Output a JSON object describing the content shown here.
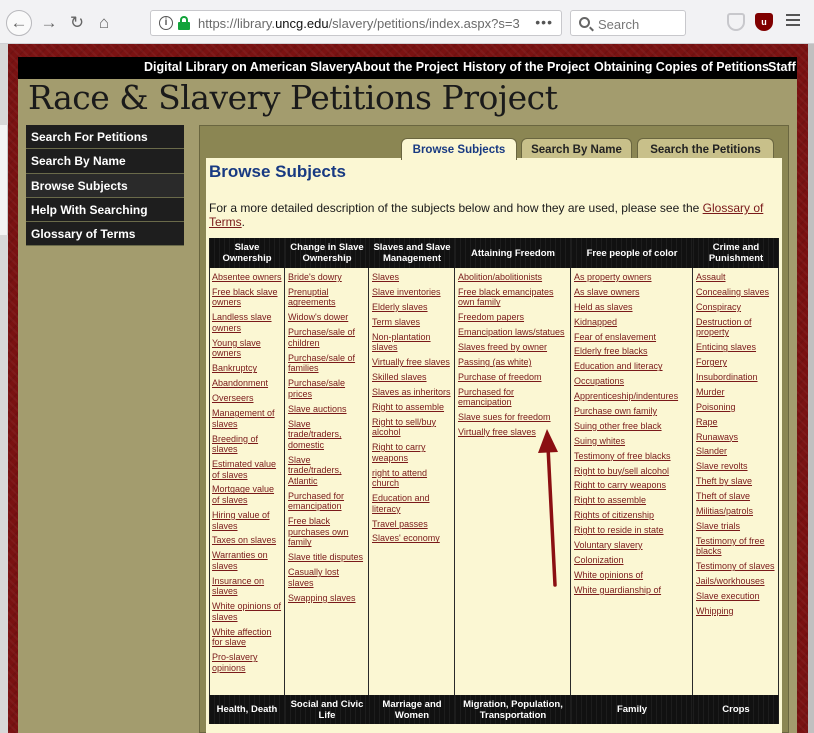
{
  "browser": {
    "url_prefix": "https://library.",
    "url_domain": "uncg.edu",
    "url_suffix": "/slavery/petitions/index.aspx?s=3",
    "search_placeholder": "Search",
    "more_label": "•••",
    "ublock_label": "u"
  },
  "site": {
    "title": "Race & Slavery Petitions Project",
    "topnav": [
      "Digital Library on American Slavery",
      "About the Project",
      "History of the Project",
      "Obtaining Copies of Petitions",
      "Staff"
    ]
  },
  "sidebar": {
    "items": [
      "Search For Petitions",
      "Search By Name",
      "Browse Subjects",
      "Help With Searching",
      "Glossary of Terms"
    ]
  },
  "tabs": {
    "browse": "Browse Subjects",
    "by_name": "Search By Name",
    "search": "Search the Petitions"
  },
  "main": {
    "title": "Browse Subjects",
    "intro_text": "For a more detailed description of the subjects below and how they are used, please see the ",
    "intro_link": "Glossary of Terms",
    "intro_end": "."
  },
  "subjects": {
    "columns": [
      {
        "header": "Slave Ownership",
        "items": [
          "Absentee owners",
          "Free black slave owners",
          "Landless slave owners",
          "Young slave owners",
          "Bankruptcy",
          "Abandonment",
          "Overseers",
          "Management of slaves",
          "Breeding of slaves",
          "Estimated value of slaves",
          "Mortgage value of slaves",
          "Hiring value of slaves",
          "Taxes on slaves",
          "Warranties on slaves",
          "Insurance on slaves",
          "White opinions of slaves",
          "White affection for slave",
          "Pro-slavery opinions"
        ]
      },
      {
        "header": "Change in Slave Ownership",
        "items": [
          "Bride's dowry",
          "Prenuptial agreements",
          "Widow's dower",
          "Purchase/sale of children",
          "Purchase/sale of families",
          "Purchase/sale prices",
          "Slave auctions",
          "Slave trade/traders, domestic",
          "Slave trade/traders, Atlantic",
          "Purchased for emancipation",
          "Free black purchases own family",
          "Slave title disputes",
          "Casually lost slaves",
          "Swapping slaves"
        ]
      },
      {
        "header": "Slaves and Slave Management",
        "items": [
          "Slaves",
          "Slave inventories",
          "Elderly slaves",
          "Term slaves",
          "Non-plantation slaves",
          "Virtually free slaves",
          "Skilled slaves",
          "Slaves as inheritors",
          "Right to assemble",
          "Right to sell/buy alcohol",
          "Right to carry weapons",
          "right to attend church",
          "Education and literacy",
          "Travel passes",
          "Slaves' economy"
        ]
      },
      {
        "header": "Attaining Freedom",
        "items": [
          "Abolition/abolitionists",
          "Free black emancipates own family",
          "Freedom papers",
          "Emancipation laws/statues",
          "Slaves freed by owner",
          "Passing (as white)",
          "Purchase of freedom",
          "Purchased for emancipation",
          "Slave sues for freedom",
          "Virtually free slaves"
        ]
      },
      {
        "header": "Free people of color",
        "items": [
          "As property owners",
          "As slave owners",
          "Held as slaves",
          "Kidnapped",
          "Fear of enslavement",
          "Elderly free blacks",
          "Education and literacy",
          "Occupations",
          "Apprenticeship/indentures",
          "Purchase own family",
          "Suing other free black",
          "Suing whites",
          "Testimony of free blacks",
          "Right to buy/sell alcohol",
          "Right to carry weapons",
          "Right to assemble",
          "Rights of citizenship",
          "Right to reside in state",
          "Voluntary slavery",
          "Colonization",
          "White opinions of",
          "White guardianship of"
        ]
      },
      {
        "header": "Crime and Punishment",
        "items": [
          "Assault",
          "Concealing slaves",
          "Conspiracy",
          "Destruction of property",
          "Enticing slaves",
          "Forgery",
          "Insubordination",
          "Murder",
          "Poisoning",
          "Rape",
          "Runaways",
          "Slander",
          "Slave revolts",
          "Theft by slave",
          "Theft of slave",
          "Militias/patrols",
          "Slave trials",
          "Testimony of free blacks",
          "Testimony of slaves",
          "Jails/workhouses",
          "Slave execution",
          "Whipping"
        ]
      }
    ],
    "second_row_headers": [
      "Health, Death",
      "Social and Civic Life",
      "Marriage and Women",
      "Migration, Population, Transportation",
      "Family",
      "Crops"
    ]
  },
  "colors": {
    "frame": "#7a1212",
    "nav_bg": "#000000",
    "panel_bg": "#a39c6e",
    "content_bg": "#fbf7d3",
    "title_blue": "#183a82",
    "link": "#7a1a1a",
    "arrow": "#8b0f12"
  }
}
